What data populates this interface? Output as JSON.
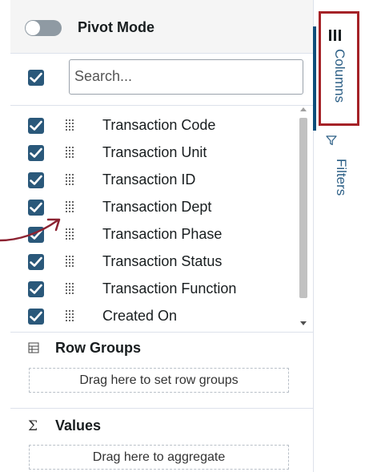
{
  "pivot_mode": {
    "label": "Pivot Mode",
    "enabled": false
  },
  "search": {
    "placeholder": "Search...",
    "value": ""
  },
  "select_all_checked": true,
  "columns": [
    {
      "label": "Transaction Code",
      "checked": true
    },
    {
      "label": "Transaction Unit",
      "checked": true
    },
    {
      "label": "Transaction ID",
      "checked": true
    },
    {
      "label": "Transaction Dept",
      "checked": true
    },
    {
      "label": "Transaction Phase",
      "checked": true
    },
    {
      "label": "Transaction Status",
      "checked": true
    },
    {
      "label": "Transaction Function",
      "checked": true
    },
    {
      "label": "Created On",
      "checked": true
    }
  ],
  "row_groups": {
    "title": "Row Groups",
    "icon": "row-groups-icon",
    "dropzone": "Drag here to set row groups"
  },
  "values": {
    "title": "Values",
    "icon": "sigma-icon",
    "symbol": "Σ",
    "dropzone": "Drag here to aggregate"
  },
  "side_tabs": [
    {
      "label": "Columns",
      "icon": "columns-icon",
      "active": true
    },
    {
      "label": "Filters",
      "icon": "filter-icon",
      "active": false
    }
  ],
  "colors": {
    "accent": "#2a587a",
    "tab_text": "#2b5e85",
    "highlight_box": "#a52227",
    "annotation_arrow": "#8c2332"
  }
}
